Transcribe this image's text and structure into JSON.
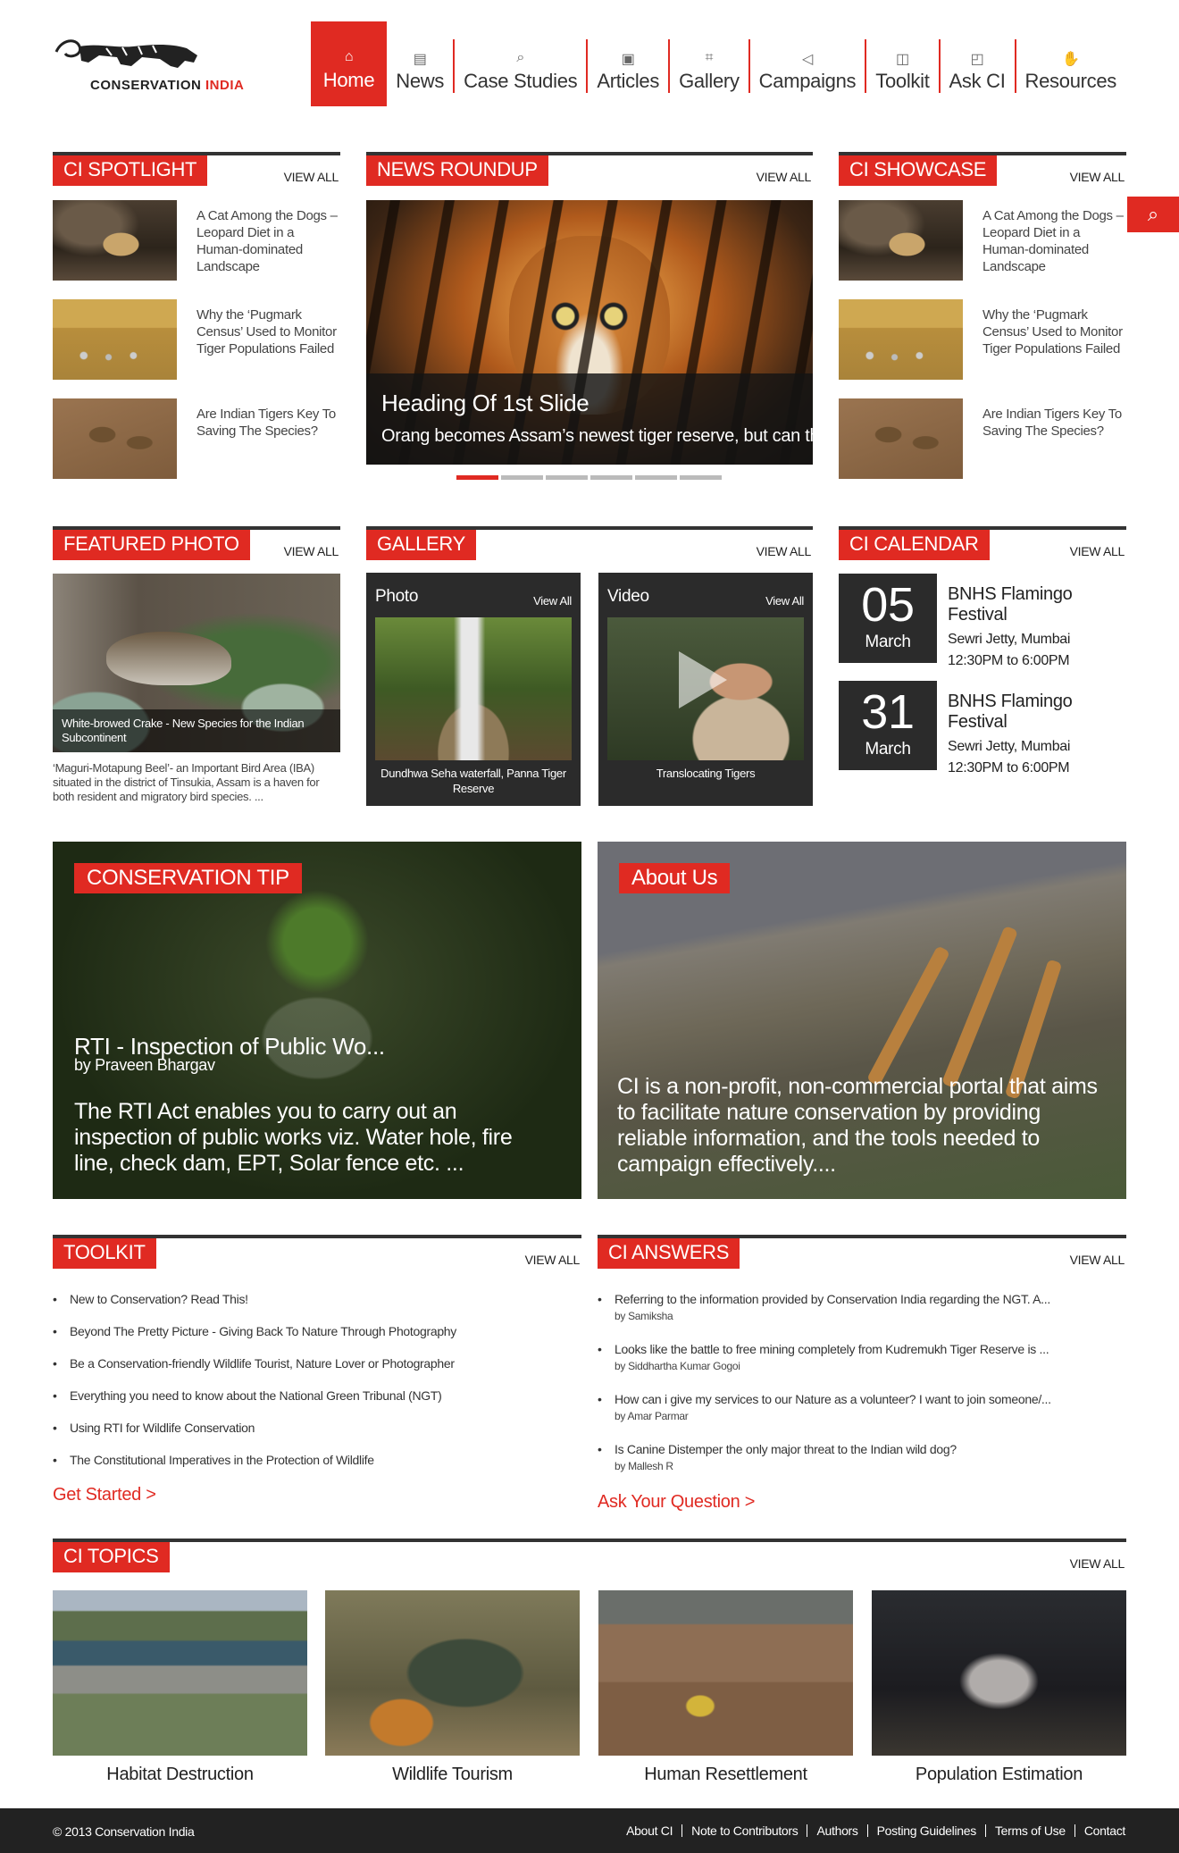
{
  "brand": {
    "name_main": "CONSERVATION ",
    "name_accent": "INDIA",
    "accent": "#e02a22"
  },
  "nav": [
    {
      "label": "Home",
      "icon": "home-icon"
    },
    {
      "label": "News",
      "icon": "newspaper-icon"
    },
    {
      "label": "Case Studies",
      "icon": "magnifier-icon"
    },
    {
      "label": "Articles",
      "icon": "article-icon"
    },
    {
      "label": "Gallery",
      "icon": "frame-icon"
    },
    {
      "label": "Campaigns",
      "icon": "megaphone-icon"
    },
    {
      "label": "Toolkit",
      "icon": "briefcase-icon"
    },
    {
      "label": "Ask CI",
      "icon": "chat-icon"
    },
    {
      "label": "Resources",
      "icon": "hands-icon"
    }
  ],
  "view_all": "VIEW ALL",
  "spotlight": {
    "title": "CI SPOTLIGHT",
    "items": [
      "A Cat Among the Dogs – Leopard Diet in a Human-dominated Landscape",
      "Why the ‘Pugmark Census’ Used to Monitor Tiger Populations Failed",
      "Are Indian Tigers Key To Saving The Species?"
    ]
  },
  "news": {
    "title": "NEWS ROUNDUP",
    "slide_heading": "Heading Of 1st Slide",
    "slide_sub": "Orang becomes Assam’s newest tiger reserve, but can the",
    "slides": 6,
    "active_slide": 1
  },
  "showcase": {
    "title": "CI SHOWCASE",
    "items": [
      "A Cat Among the Dogs – Leopard Diet in a Human-dominated Landscape",
      "Why the ‘Pugmark Census’ Used to Monitor Tiger Populations Failed",
      "Are Indian Tigers Key To Saving The Species?"
    ]
  },
  "featured": {
    "title": "FEATURED PHOTO",
    "caption": "White-browed Crake - New Species for the Indian Subcontinent",
    "desc": "‘Maguri-Motapung Beel’- an Important Bird Area (IBA) situated in the district of Tinsukia, Assam is a haven for both resident and migratory bird species. ..."
  },
  "gallery": {
    "title": "GALLERY",
    "photo": {
      "label": "Photo",
      "view_all": "View All",
      "caption": "Dundhwa Seha waterfall, Panna Tiger Reserve"
    },
    "video": {
      "label": "Video",
      "view_all": "View All",
      "caption": "Translocating Tigers"
    }
  },
  "calendar": {
    "title": "CI CALENDAR",
    "events": [
      {
        "day": "05",
        "month": "March",
        "name": "BNHS Flamingo Festival",
        "place": "Sewri Jetty, Mumbai",
        "time": "12:30PM to 6:00PM"
      },
      {
        "day": "31",
        "month": "March",
        "name": "BNHS Flamingo Festival",
        "place": "Sewri Jetty, Mumbai",
        "time": "12:30PM to 6:00PM"
      }
    ]
  },
  "tip": {
    "title": "CONSERVATION TIP",
    "heading": "RTI - Inspection of Public Wo...",
    "author": "by Praveen Bhargav",
    "body": "The RTI Act enables you to carry out an inspection of public works viz. Water hole, fire line, check dam, EPT, Solar fence etc. ..."
  },
  "about": {
    "title": "About Us",
    "body": "CI is a non-profit, non-commercial portal that aims to facilitate nature conservation by providing reliable information, and the tools needed to campaign effectively...."
  },
  "toolkit": {
    "title": "TOOLKIT",
    "items": [
      "New to Conservation? Read This!",
      "Beyond The Pretty Picture - Giving Back To Nature Through Photography",
      "Be a Conservation-friendly Wildlife Tourist, Nature Lover or Photographer",
      "Everything you need to know about the National Green Tribunal (NGT)",
      "Using RTI for Wildlife Conservation",
      "The Constitutional Imperatives in the Protection of Wildlife"
    ],
    "cta": "Get Started >"
  },
  "answers": {
    "title": "CI ANSWERS",
    "items": [
      {
        "q": "Referring to the information provided by Conservation India regarding the NGT. A...",
        "by": "by Samiksha"
      },
      {
        "q": "Looks like the battle to free mining completely from Kudremukh Tiger Reserve is ...",
        "by": "by Siddhartha Kumar Gogoi"
      },
      {
        "q": "How can i give my services to our Nature as a volunteer? I want to join someone/...",
        "by": "by Amar Parmar"
      },
      {
        "q": "Is Canine Distemper the only major threat to the Indian wild dog?",
        "by": "by Mallesh R"
      }
    ],
    "cta": "Ask Your Question >"
  },
  "topics": {
    "title": "CI TOPICS",
    "items": [
      "Habitat Destruction",
      "Wildlife Tourism",
      "Human Resettlement",
      "Population Estimation"
    ]
  },
  "footer": {
    "copyright": "© 2013 Conservation India",
    "links": [
      "About CI",
      "Note to Contributors",
      "Authors",
      "Posting Guidelines",
      "Terms of Use",
      "Contact"
    ]
  }
}
